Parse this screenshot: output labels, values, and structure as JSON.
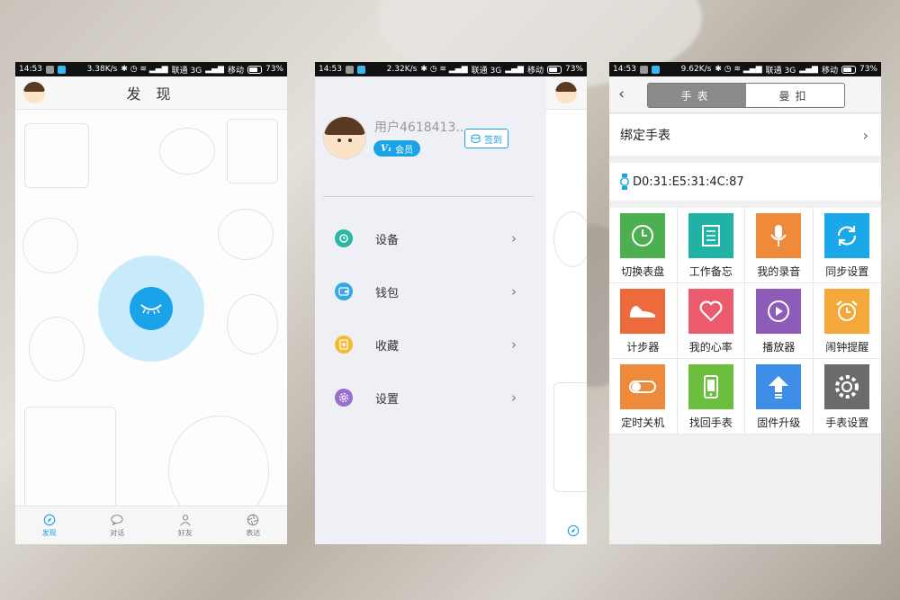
{
  "status_bar_1": {
    "time": "14:53",
    "speed": "3.38K/s",
    "carrier1": "联通 3G",
    "carrier2": "移动",
    "battery": "73%"
  },
  "status_bar_2": {
    "time": "14:53",
    "speed": "2.32K/s",
    "carrier1": "联通 3G",
    "carrier2": "移动",
    "battery": "73%"
  },
  "status_bar_3": {
    "time": "14:53",
    "speed": "9.62K/s",
    "carrier1": "联通 3G",
    "carrier2": "移动",
    "battery": "73%"
  },
  "screen1": {
    "title": "发 现",
    "tabs": [
      {
        "label": "发现",
        "icon": "compass-icon"
      },
      {
        "label": "对话",
        "icon": "chat-bubble-icon"
      },
      {
        "label": "好友",
        "icon": "friends-icon"
      },
      {
        "label": "表达",
        "icon": "aperture-icon"
      }
    ]
  },
  "screen2": {
    "username": "用户4618413...",
    "vip_label": "会员",
    "vip_level": "V₁",
    "checkin_label": "签到",
    "menu": [
      {
        "label": "设备",
        "icon": "device-icon",
        "color": "#2bb6a8"
      },
      {
        "label": "钱包",
        "icon": "wallet-icon",
        "color": "#35a9e8"
      },
      {
        "label": "收藏",
        "icon": "favorite-icon",
        "color": "#f5b932"
      },
      {
        "label": "设置",
        "icon": "settings-icon",
        "color": "#9a6fd0"
      }
    ]
  },
  "screen3": {
    "tab_watch": "手表",
    "tab_band": "曼扣",
    "bind_label": "绑定手表",
    "mac": "D0:31:E5:31:4C:87",
    "grid": [
      {
        "label": "切换表盘",
        "icon": "clock-icon",
        "color": "#4caf50"
      },
      {
        "label": "工作备忘",
        "icon": "memo-icon",
        "color": "#20b2a4"
      },
      {
        "label": "我的录音",
        "icon": "microphone-icon",
        "color": "#ef8a3a"
      },
      {
        "label": "同步设置",
        "icon": "sync-icon",
        "color": "#1ba8e8"
      },
      {
        "label": "计步器",
        "icon": "sneaker-icon",
        "color": "#ec6a3b"
      },
      {
        "label": "我的心率",
        "icon": "heart-icon",
        "color": "#ec5b6d"
      },
      {
        "label": "播放器",
        "icon": "play-icon",
        "color": "#8e5bb8"
      },
      {
        "label": "闹钟提醒",
        "icon": "alarm-icon",
        "color": "#f5a83a"
      },
      {
        "label": "定时关机",
        "icon": "power-switch-icon",
        "color": "#ef8a3a"
      },
      {
        "label": "找回手表",
        "icon": "phone-find-icon",
        "color": "#6cbf3c"
      },
      {
        "label": "固件升级",
        "icon": "upgrade-icon",
        "color": "#3c8ee6"
      },
      {
        "label": "手表设置",
        "icon": "gear-icon",
        "color": "#6b6b6b"
      }
    ]
  }
}
